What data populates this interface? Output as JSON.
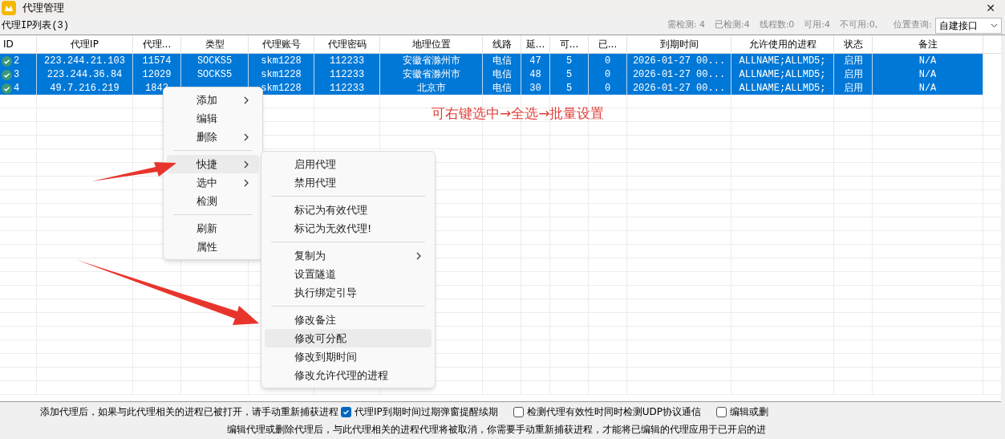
{
  "window": {
    "title": "代理管理",
    "close": "✕"
  },
  "toolbar": {
    "list_title": "代理IP列表(3)",
    "stats": [
      "需检测: 4",
      "已检测:4",
      "线程数:0",
      "可用:4",
      "不可用:0,"
    ],
    "location_label": "位置查询:",
    "location_value": "自建接口"
  },
  "table": {
    "columns": [
      "ID",
      "代理IP",
      "代理...",
      "类型",
      "代理账号",
      "代理密码",
      "地理位置",
      "线路",
      "延...",
      "可...",
      "已...",
      "到期时间",
      "允许使用的进程",
      "状态",
      "备注"
    ],
    "rows": [
      {
        "selected": true,
        "cells": [
          "2",
          "223.244.21.103",
          "11574",
          "SOCKS5",
          "skm1228",
          "112233",
          "安徽省滁州市",
          "电信",
          "47",
          "5",
          "0",
          "2026-01-27 00...",
          "ALLNAME;ALLMD5;",
          "启用",
          "N/A"
        ]
      },
      {
        "selected": true,
        "cells": [
          "3",
          "223.244.36.84",
          "12029",
          "SOCKS5",
          "skm1228",
          "112233",
          "安徽省滁州市",
          "电信",
          "48",
          "5",
          "0",
          "2026-01-27 00...",
          "ALLNAME;ALLMD5;",
          "启用",
          "N/A"
        ]
      },
      {
        "selected": true,
        "cells": [
          "4",
          "49.7.216.219",
          "1842",
          null,
          "skm1228",
          "112233",
          "北京市",
          "电信",
          "30",
          "5",
          "0",
          "2026-01-27 00...",
          "ALLNAME;ALLMD5;",
          "启用",
          "N/A"
        ]
      }
    ]
  },
  "annotation": "可右键选中→全选→批量设置",
  "context_menu": {
    "items": [
      {
        "kind": "item",
        "label": "添加",
        "submenu": true,
        "selected": false
      },
      {
        "kind": "item",
        "label": "编辑",
        "submenu": false,
        "selected": false
      },
      {
        "kind": "item",
        "label": "删除",
        "submenu": true,
        "selected": false
      },
      {
        "kind": "separator"
      },
      {
        "kind": "item",
        "label": "快捷",
        "submenu": true,
        "selected": true
      },
      {
        "kind": "item",
        "label": "选中",
        "submenu": true,
        "selected": false
      },
      {
        "kind": "item",
        "label": "检测",
        "submenu": false,
        "selected": false
      },
      {
        "kind": "separator"
      },
      {
        "kind": "item",
        "label": "刷新",
        "submenu": false,
        "selected": false
      },
      {
        "kind": "item",
        "label": "属性",
        "submenu": false,
        "selected": false
      }
    ]
  },
  "submenu": {
    "items": [
      {
        "kind": "item",
        "label": "启用代理",
        "submenu": false,
        "selected": false
      },
      {
        "kind": "item",
        "label": "禁用代理",
        "submenu": false,
        "selected": false
      },
      {
        "kind": "separator"
      },
      {
        "kind": "item",
        "label": "标记为有效代理",
        "submenu": false,
        "selected": false
      },
      {
        "kind": "item",
        "label": "标记为无效代理!",
        "submenu": false,
        "selected": false
      },
      {
        "kind": "separator"
      },
      {
        "kind": "item",
        "label": "复制为",
        "submenu": true,
        "selected": false
      },
      {
        "kind": "item",
        "label": "设置隧道",
        "submenu": false,
        "selected": false
      },
      {
        "kind": "item",
        "label": "执行绑定引导",
        "submenu": false,
        "selected": false
      },
      {
        "kind": "separator"
      },
      {
        "kind": "item",
        "label": "修改备注",
        "submenu": false,
        "selected": false
      },
      {
        "kind": "item",
        "label": "修改可分配",
        "submenu": false,
        "selected": true
      },
      {
        "kind": "item",
        "label": "修改到期时间",
        "submenu": false,
        "selected": false
      },
      {
        "kind": "item",
        "label": "修改允许代理的进程",
        "submenu": false,
        "selected": false
      }
    ]
  },
  "footer": {
    "note": "添加代理后，如果与此代理相关的进程已被打开，请手动重新捕获进程",
    "options": [
      {
        "label": "代理IP到期时间过期弹窗提醒续期",
        "checked": true
      },
      {
        "label": "检测代理有效性时同时检测UDP协议通信",
        "checked": false
      },
      {
        "label": "编辑或删",
        "checked": false
      }
    ],
    "note2": "编辑代理或删除代理后，与此代理相关的进程代理将被取消，你需要手动重新捕获进程，才能将已编辑的代理应用于已开启的进"
  }
}
